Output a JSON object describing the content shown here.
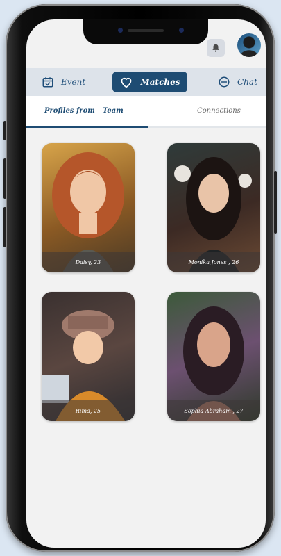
{
  "topnav": {
    "event_label": "Event",
    "matches_label": "Matches",
    "chat_label": "Chat"
  },
  "subtabs": {
    "profiles_label": "Profiles from",
    "team_label": "Team",
    "connections_label": "Connections"
  },
  "profiles": [
    {
      "caption": "Daisy, 23"
    },
    {
      "caption": "Monika Jones , 26"
    },
    {
      "caption": "Rima, 25"
    },
    {
      "caption": "Sophia Abraham , 27"
    }
  ],
  "colors": {
    "accent": "#1e4c73",
    "nav_bg": "#dde3ea",
    "screen_bg": "#f2f2f2"
  },
  "icons": {
    "event": "calendar-check-icon",
    "matches": "heart-icon",
    "chat": "chat-bubble-icon",
    "notifications": "bell-icon"
  }
}
